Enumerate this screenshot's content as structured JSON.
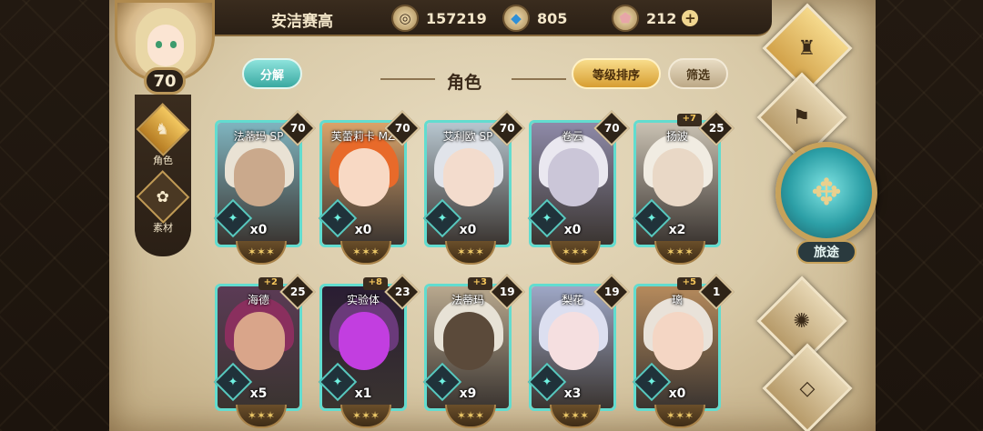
{
  "header": {
    "player_name": "安洁赛高",
    "player_level": "70",
    "currencies": [
      {
        "icon": "gold-coin-icon",
        "value": "157219"
      },
      {
        "icon": "blue-crystal-icon",
        "value": "805"
      },
      {
        "icon": "pink-gem-icon",
        "value": "212"
      }
    ]
  },
  "side_tabs": [
    {
      "label": "角色",
      "icon": "character-helmet-icon",
      "active": true
    },
    {
      "label": "素材",
      "icon": "material-beast-icon",
      "active": false
    }
  ],
  "toolbar": {
    "decompose_label": "分解",
    "title": "角色",
    "sort_label": "等级排序",
    "filter_label": "筛选"
  },
  "characters": [
    {
      "name": "法蒂玛 SP",
      "level": "70",
      "bonus": "",
      "count": "x0",
      "colors": {
        "bg": "#7fb4bf",
        "hair": "#e9e2d4",
        "skin": "#caa98c"
      }
    },
    {
      "name": "芙蕾莉卡 MZ",
      "level": "70",
      "bonus": "",
      "count": "x0",
      "colors": {
        "bg": "#d9a36a",
        "hair": "#e86a2a",
        "skin": "#f8d9c4"
      }
    },
    {
      "name": "艾利欧 SP",
      "level": "70",
      "bonus": "",
      "count": "x0",
      "colors": {
        "bg": "#b7c6cf",
        "hair": "#e1e4ea",
        "skin": "#f3dccd"
      }
    },
    {
      "name": "卷云",
      "level": "70",
      "bonus": "",
      "count": "x0",
      "colors": {
        "bg": "#8e8aa8",
        "hair": "#eae8f0",
        "skin": "#cbc6d8"
      }
    },
    {
      "name": "扬波",
      "level": "25",
      "bonus": "+7",
      "count": "x2",
      "colors": {
        "bg": "#c9c1b2",
        "hair": "#f1ece2",
        "skin": "#e9d8c6"
      }
    },
    {
      "name": "海德",
      "level": "25",
      "bonus": "+2",
      "count": "x5",
      "colors": {
        "bg": "#5b3b55",
        "hair": "#8a2f5e",
        "skin": "#d9a58a"
      }
    },
    {
      "name": "实验体",
      "level": "23",
      "bonus": "+8",
      "count": "x1",
      "colors": {
        "bg": "#2a1d33",
        "hair": "#6a3a7a",
        "skin": "#c23ee0"
      }
    },
    {
      "name": "法蒂玛",
      "level": "19",
      "bonus": "+3",
      "count": "x9",
      "colors": {
        "bg": "#b8a88e",
        "hair": "#e7e2d6",
        "skin": "#5b4a3a"
      }
    },
    {
      "name": "梨花",
      "level": "19",
      "bonus": "",
      "count": "x3",
      "colors": {
        "bg": "#9ea7c6",
        "hair": "#dcdff0",
        "skin": "#f5dfe0"
      }
    },
    {
      "name": "璃",
      "level": "1",
      "bonus": "+5",
      "count": "x0",
      "colors": {
        "bg": "#b58a5c",
        "hair": "#e9e2d9",
        "skin": "#f4d6c4"
      }
    }
  ],
  "right_nav": [
    {
      "label": "魂册",
      "icon": "soul-book-icon",
      "active": true
    },
    {
      "label": "公会",
      "icon": "guild-banner-icon",
      "active": false
    },
    {
      "label": "赋魂",
      "icon": "soul-flame-icon",
      "active": false
    },
    {
      "label": "市集",
      "icon": "market-gem-icon",
      "active": false
    }
  ],
  "journey": {
    "label": "旅途",
    "icon": "compass-crest-icon"
  }
}
